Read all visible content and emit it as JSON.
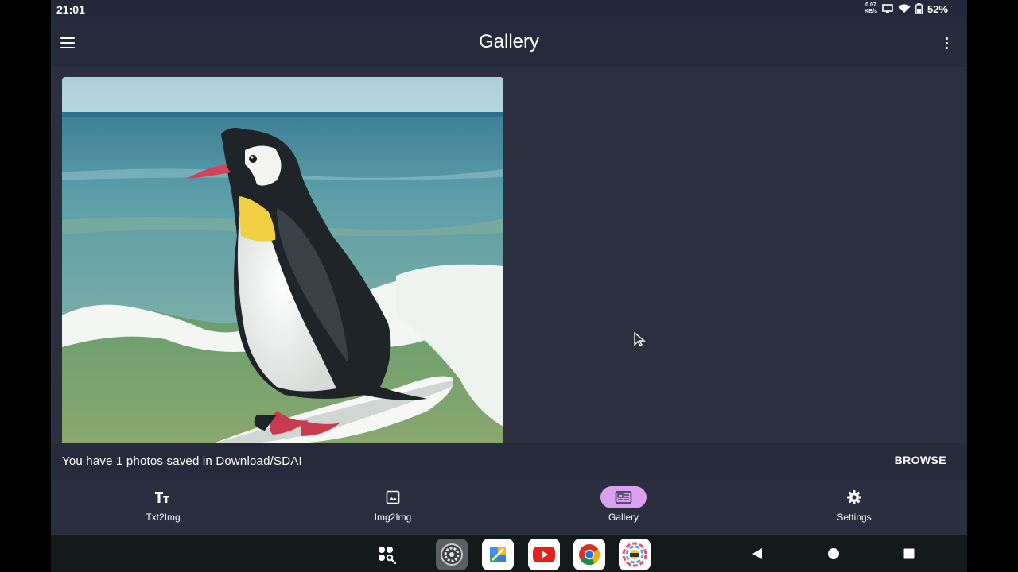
{
  "status_bar": {
    "time": "21:01",
    "net_speed": "0.07",
    "net_unit": "KB/s",
    "battery": "52%"
  },
  "app_bar": {
    "title": "Gallery",
    "menu_icon": "menu-icon",
    "overflow_icon": "more-vert-icon"
  },
  "gallery": {
    "photo_subject": "penguin surfing"
  },
  "saved_bar": {
    "message": "You have 1 photos saved in Download/SDAI",
    "browse_label": "BROWSE"
  },
  "bottom_nav": {
    "items": [
      {
        "label": "Txt2Img",
        "icon": "text-icon",
        "active": false
      },
      {
        "label": "Img2Img",
        "icon": "image-icon",
        "active": false
      },
      {
        "label": "Gallery",
        "icon": "gallery-icon",
        "active": true
      },
      {
        "label": "Settings",
        "icon": "gear-icon",
        "active": false
      }
    ],
    "active_color": "#d9a1f0"
  },
  "dock": {
    "apps": [
      "app-drawer-icon",
      "settings-app-icon",
      "photos-app-icon",
      "youtube-app-icon",
      "chrome-app-icon",
      "sdai-app-icon"
    ]
  }
}
